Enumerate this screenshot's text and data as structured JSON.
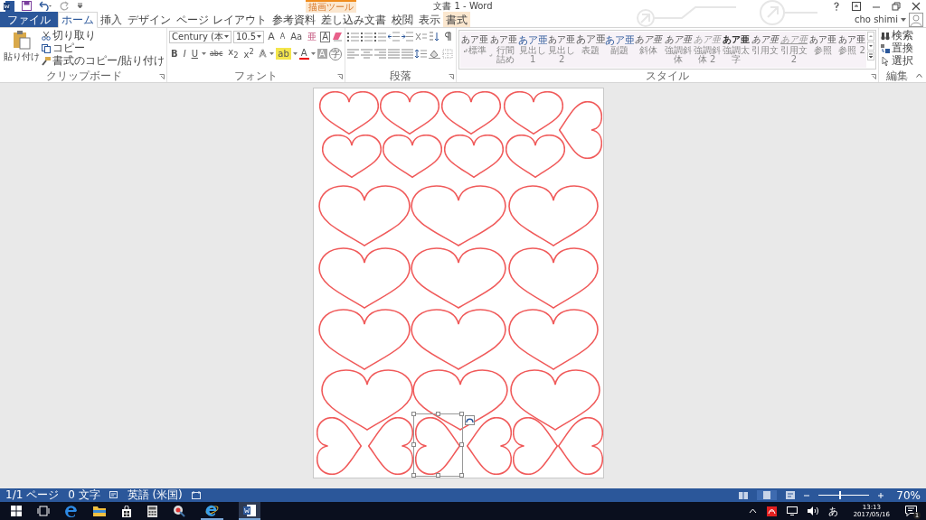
{
  "window": {
    "title": "文書 1 - Word",
    "contextual_group": "描画ツール",
    "user": "cho shimi"
  },
  "tabs": [
    {
      "label": "ファイル",
      "kind": "file",
      "selected": false
    },
    {
      "label": "ホーム",
      "kind": "normal",
      "selected": true
    },
    {
      "label": "挿入",
      "kind": "normal",
      "selected": false
    },
    {
      "label": "デザイン",
      "kind": "normal",
      "selected": false
    },
    {
      "label": "ページ レイアウト",
      "kind": "normal",
      "selected": false
    },
    {
      "label": "参考資料",
      "kind": "normal",
      "selected": false
    },
    {
      "label": "差し込み文書",
      "kind": "normal",
      "selected": false
    },
    {
      "label": "校閲",
      "kind": "normal",
      "selected": false
    },
    {
      "label": "表示",
      "kind": "normal",
      "selected": false
    },
    {
      "label": "書式",
      "kind": "contextual",
      "selected": false
    }
  ],
  "clipboard": {
    "label": "クリップボード",
    "paste": "貼り付け",
    "items": [
      {
        "label": "切り取り",
        "kind": "cut"
      },
      {
        "label": "コピー",
        "kind": "copy"
      },
      {
        "label": "書式のコピー/貼り付け",
        "kind": "painter"
      }
    ]
  },
  "font": {
    "label": "フォント",
    "name": "Century (本",
    "size": "10.5",
    "row1": [
      {
        "label": "A",
        "kind": "grow"
      },
      {
        "label": "A",
        "kind": "shrink"
      },
      {
        "label": "Aa",
        "kind": "case"
      },
      {
        "label": "亜",
        "kind": "ruby"
      },
      {
        "label": "A",
        "kind": "boxed"
      }
    ],
    "row2": [
      {
        "label": "B",
        "kind": "bold"
      },
      {
        "label": "I",
        "kind": "italic"
      },
      {
        "label": "U",
        "kind": "underline"
      },
      {
        "label": "abc",
        "kind": "strike"
      },
      {
        "label": "x$_{2}$",
        "kind": "plain"
      },
      {
        "label": "x$^{2}$",
        "kind": "plain"
      },
      {
        "label": "A",
        "kind": "effects"
      },
      {
        "label": "ab",
        "kind": "highlight"
      },
      {
        "label": "A",
        "kind": "color"
      },
      {
        "label": "A",
        "kind": "shaded"
      },
      {
        "label": "字",
        "kind": "circled"
      }
    ]
  },
  "paragraph": {
    "label": "段落"
  },
  "styles": {
    "label": "スタイル",
    "items": [
      {
        "sample": "あア亜",
        "label": "標準",
        "kind": "plain",
        "paragraph_mark": true
      },
      {
        "sample": "あア亜",
        "label": "行間詰め",
        "kind": "plain",
        "paragraph_mark": true
      },
      {
        "sample": "あア亜",
        "label": "見出し 1",
        "kind": "heading",
        "paragraph_mark": false
      },
      {
        "sample": "あア亜",
        "label": "見出し 2",
        "kind": "plain",
        "paragraph_mark": false
      },
      {
        "sample": "あア亜",
        "label": "表題",
        "kind": "title",
        "paragraph_mark": false
      },
      {
        "sample": "あア亜",
        "label": "副題",
        "kind": "heading",
        "paragraph_mark": false
      },
      {
        "sample": "あア亜",
        "label": "斜体",
        "kind": "italic",
        "paragraph_mark": false
      },
      {
        "sample": "あア亜",
        "label": "強調斜体",
        "kind": "italic",
        "paragraph_mark": false
      },
      {
        "sample": "あア亜",
        "label": "強調斜体 2",
        "kind": "faded",
        "paragraph_mark": false
      },
      {
        "sample": "あア亜",
        "label": "強調太字",
        "kind": "bold",
        "paragraph_mark": false
      },
      {
        "sample": "あア亜",
        "label": "引用文",
        "kind": "italic",
        "paragraph_mark": false
      },
      {
        "sample": "あア亜",
        "label": "引用文 2",
        "kind": "underlined",
        "paragraph_mark": false
      },
      {
        "sample": "あア亜",
        "label": "参照",
        "kind": "plain",
        "paragraph_mark": false
      },
      {
        "sample": "あア亜",
        "label": "参照 2",
        "kind": "plain",
        "paragraph_mark": false
      }
    ]
  },
  "editing": {
    "label": "編集",
    "items": [
      {
        "label": "検索",
        "kind": "find"
      },
      {
        "label": "置換",
        "kind": "replace"
      },
      {
        "label": "選択",
        "kind": "select"
      }
    ]
  },
  "document": {
    "shapes": [
      {
        "selected": false
      },
      {
        "selected": false
      },
      {
        "selected": false
      },
      {
        "selected": false
      },
      {
        "selected": false
      },
      {
        "selected": false
      },
      {
        "selected": false
      },
      {
        "selected": false
      },
      {
        "selected": false
      },
      {
        "selected": false
      },
      {
        "selected": false
      },
      {
        "selected": false
      },
      {
        "selected": false
      },
      {
        "selected": false
      },
      {
        "selected": false
      },
      {
        "selected": false
      },
      {
        "selected": false
      },
      {
        "selected": false
      },
      {
        "selected": false
      },
      {
        "selected": false
      },
      {
        "selected": false
      },
      {
        "selected": false
      },
      {
        "selected": false
      },
      {
        "selected": true
      },
      {
        "selected": false
      },
      {
        "selected": false
      },
      {
        "selected": false
      }
    ]
  },
  "status_bar": {
    "page": "1/1 ページ",
    "words": "0 文字",
    "language": "英語 (米国)",
    "zoom": "70%",
    "zoom_slider": {
      "level": 0.42
    }
  },
  "taskbar": {
    "ime": "あ",
    "time": "13:13",
    "date": "2017/05/16",
    "notifications": "1"
  }
}
